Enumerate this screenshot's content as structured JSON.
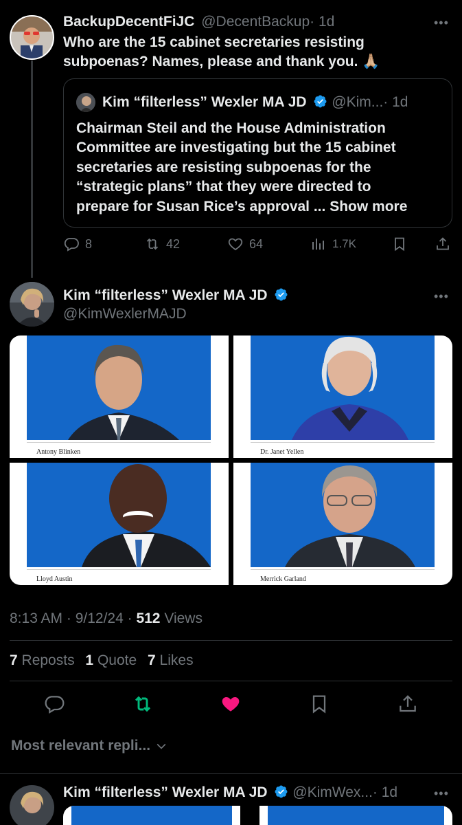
{
  "reply_tweet": {
    "display_name": "BackupDecentFiJC",
    "handle": "@DecentBackup",
    "time": "· 1d",
    "text_line1": "Who are the 15 cabinet secretaries resisting",
    "text_line2": "subpoenas? Names, please and thank you. 🙏🏼",
    "more_icon": "more-horizontal-icon",
    "quoted": {
      "display_name": "Kim “filterless” Wexler MA JD",
      "handle": "@Kim...",
      "time": "· 1d",
      "lines": [
        "Chairman Steil and the House Administration",
        "Committee are investigating but the 15 cabinet",
        "secretaries are resisting subpoenas for the",
        "“strategic plans” that they were directed to",
        "prepare for Susan Rice’s approval ... "
      ],
      "show_more": "Show more"
    },
    "actions": {
      "replies": "8",
      "reposts": "42",
      "likes": "64",
      "views": "1.7K"
    }
  },
  "main_tweet": {
    "display_name": "Kim “filterless” Wexler MA JD",
    "handle": "@KimWexlerMAJD",
    "photos": [
      {
        "caption": "Antony Blinken"
      },
      {
        "caption": "Dr. Janet Yellen"
      },
      {
        "caption": "Lloyd Austin"
      },
      {
        "caption": "Merrick Garland"
      }
    ],
    "timestamp": "8:13 AM · 9/12/24 · ",
    "views_count": "512",
    "views_label": " Views",
    "stats": {
      "reposts_count": "7",
      "reposts_label": "Reposts",
      "quotes_count": "1",
      "quotes_label": "Quote",
      "likes_count": "7",
      "likes_label": "Likes"
    },
    "liked": true
  },
  "replies_filter": {
    "label": "Most relevant repli...",
    "icon": "chevron-down-icon"
  },
  "next_reply": {
    "display_name": "Kim “filterless” Wexler MA JD",
    "handle": "@KimWex...",
    "time": "· 1d"
  },
  "colors": {
    "background": "#000000",
    "text": "#e7e9ea",
    "muted": "#71767b",
    "verified": "#1d9bf0",
    "repost_active": "#00ba7c",
    "like_active": "#f91880",
    "photo_blue": "#1467c8"
  }
}
